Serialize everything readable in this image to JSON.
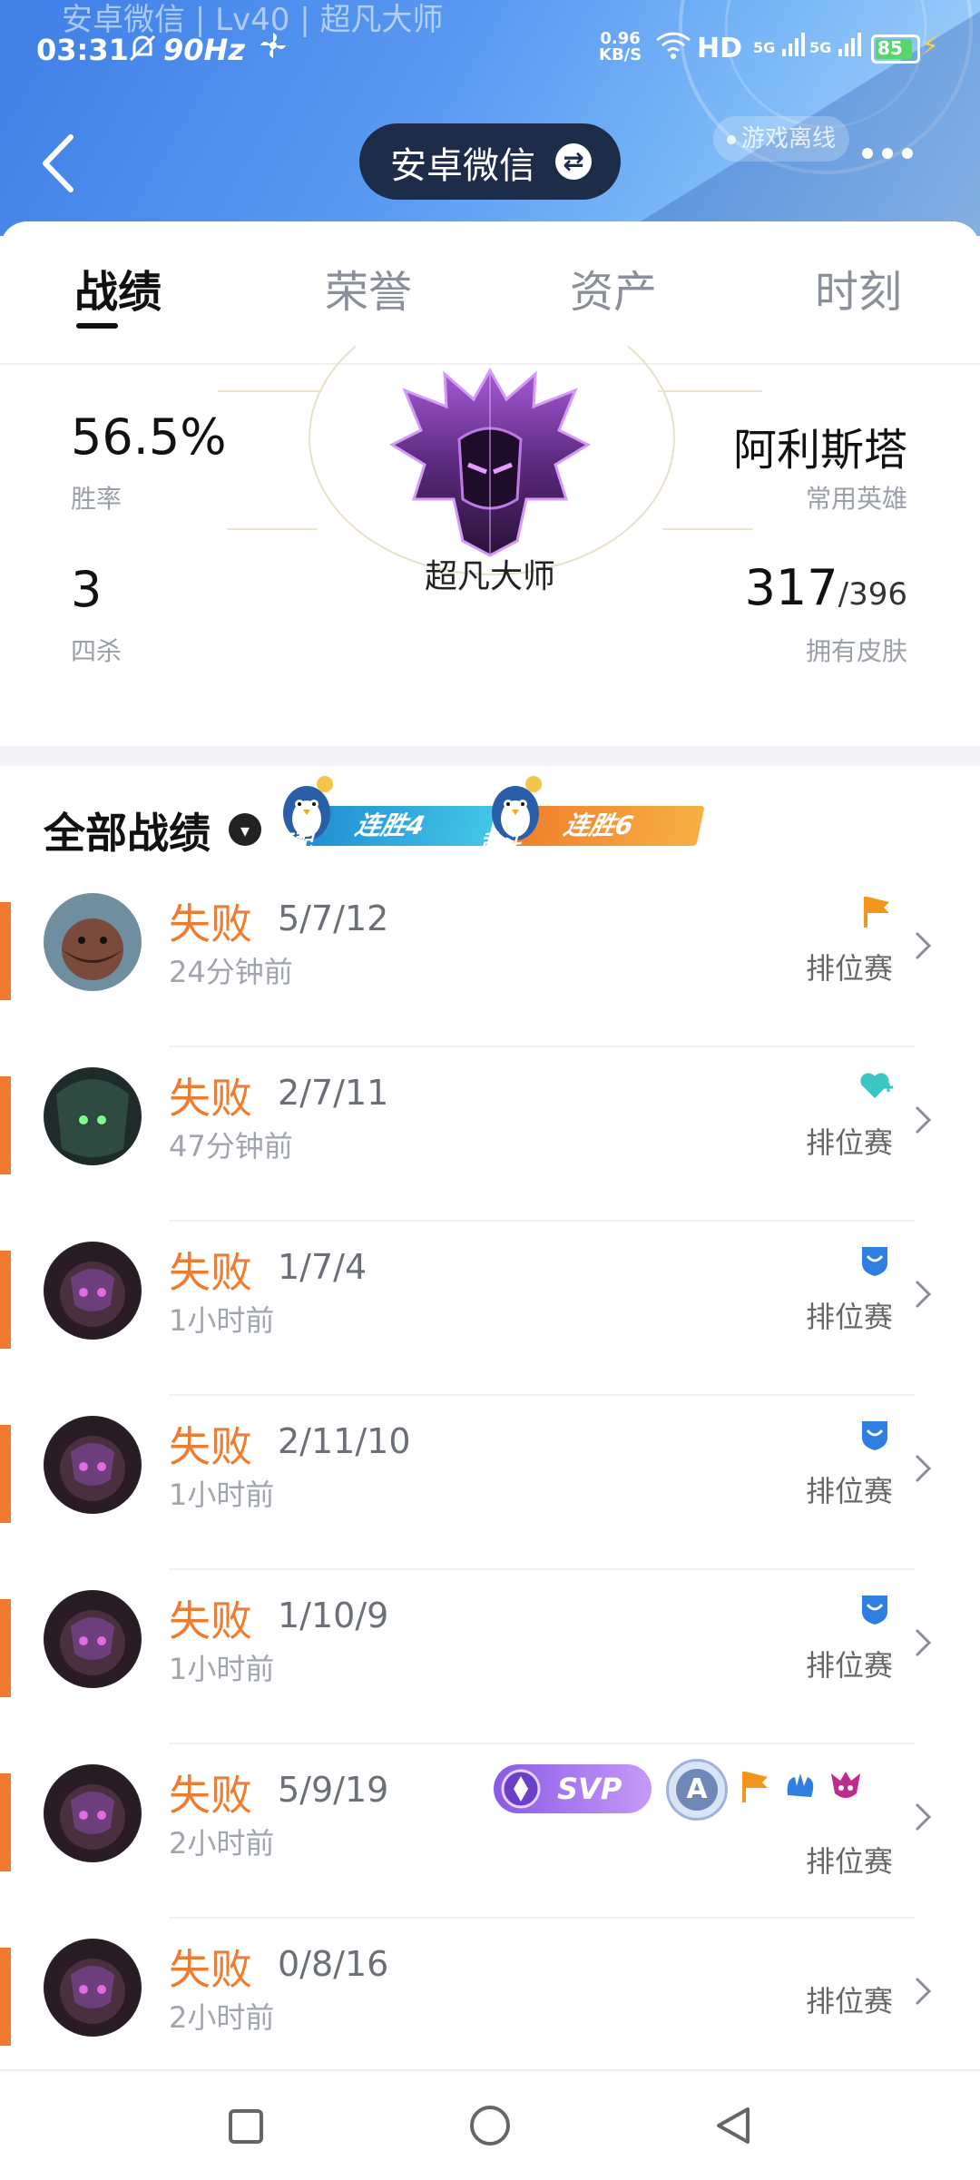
{
  "header": {
    "overlay_title": "安卓微信 | Lv40 | 超凡大师",
    "status_bar": {
      "time": "03:31",
      "refresh": "90Hz",
      "net_speed": "0.96",
      "net_unit": "KB/S",
      "hd": "HD",
      "sig1": "5G",
      "sig2": "5G",
      "battery": "85"
    },
    "account": "安卓微信",
    "game_status": "游戏离线"
  },
  "tabs": [
    "战绩",
    "荣誉",
    "资产",
    "时刻"
  ],
  "stats": {
    "win_rate": "56.5%",
    "win_rate_label": "胜率",
    "quadra_kills": "3",
    "quadra_kills_label": "四杀",
    "rank": "超凡大师",
    "common_hero": "阿利斯塔",
    "common_hero_label": "常用英雄",
    "skins_owned": "317",
    "skins_total": "/396",
    "skins_label": "拥有皮肤"
  },
  "records": {
    "title": "全部战绩",
    "streaks": [
      {
        "mode": "匹配",
        "label": "连胜4",
        "color": "#2fb6de"
      },
      {
        "mode": "乱斗",
        "label": "连胜6",
        "color": "#f29a3a"
      }
    ]
  },
  "matches": [
    {
      "result": "失败",
      "kda": "5/7/12",
      "time": "24分钟前",
      "mode": "排位赛",
      "badges": [
        "orange-flag-icon"
      ]
    },
    {
      "result": "失败",
      "kda": "2/7/11",
      "time": "47分钟前",
      "mode": "排位赛",
      "badges": [
        "heart-plus-icon"
      ]
    },
    {
      "result": "失败",
      "kda": "1/7/4",
      "time": "1小时前",
      "mode": "排位赛",
      "badges": [
        "shield-badge-icon"
      ]
    },
    {
      "result": "失败",
      "kda": "2/11/10",
      "time": "1小时前",
      "mode": "排位赛",
      "badges": [
        "shield-badge-icon"
      ]
    },
    {
      "result": "失败",
      "kda": "1/10/9",
      "time": "1小时前",
      "mode": "排位赛",
      "badges": [
        "shield-badge-icon"
      ]
    },
    {
      "result": "失败",
      "kda": "5/9/19",
      "time": "2小时前",
      "mode": "排位赛",
      "badges": [
        "svp-badge",
        "a-rating-badge",
        "orange-flag-icon",
        "blue-hand-icon",
        "purple-demon-icon"
      ],
      "svp_text": "SVP",
      "rating": "A"
    },
    {
      "result": "失败",
      "kda": "0/8/16",
      "time": "2小时前",
      "mode": "排位赛",
      "badges": []
    }
  ]
}
